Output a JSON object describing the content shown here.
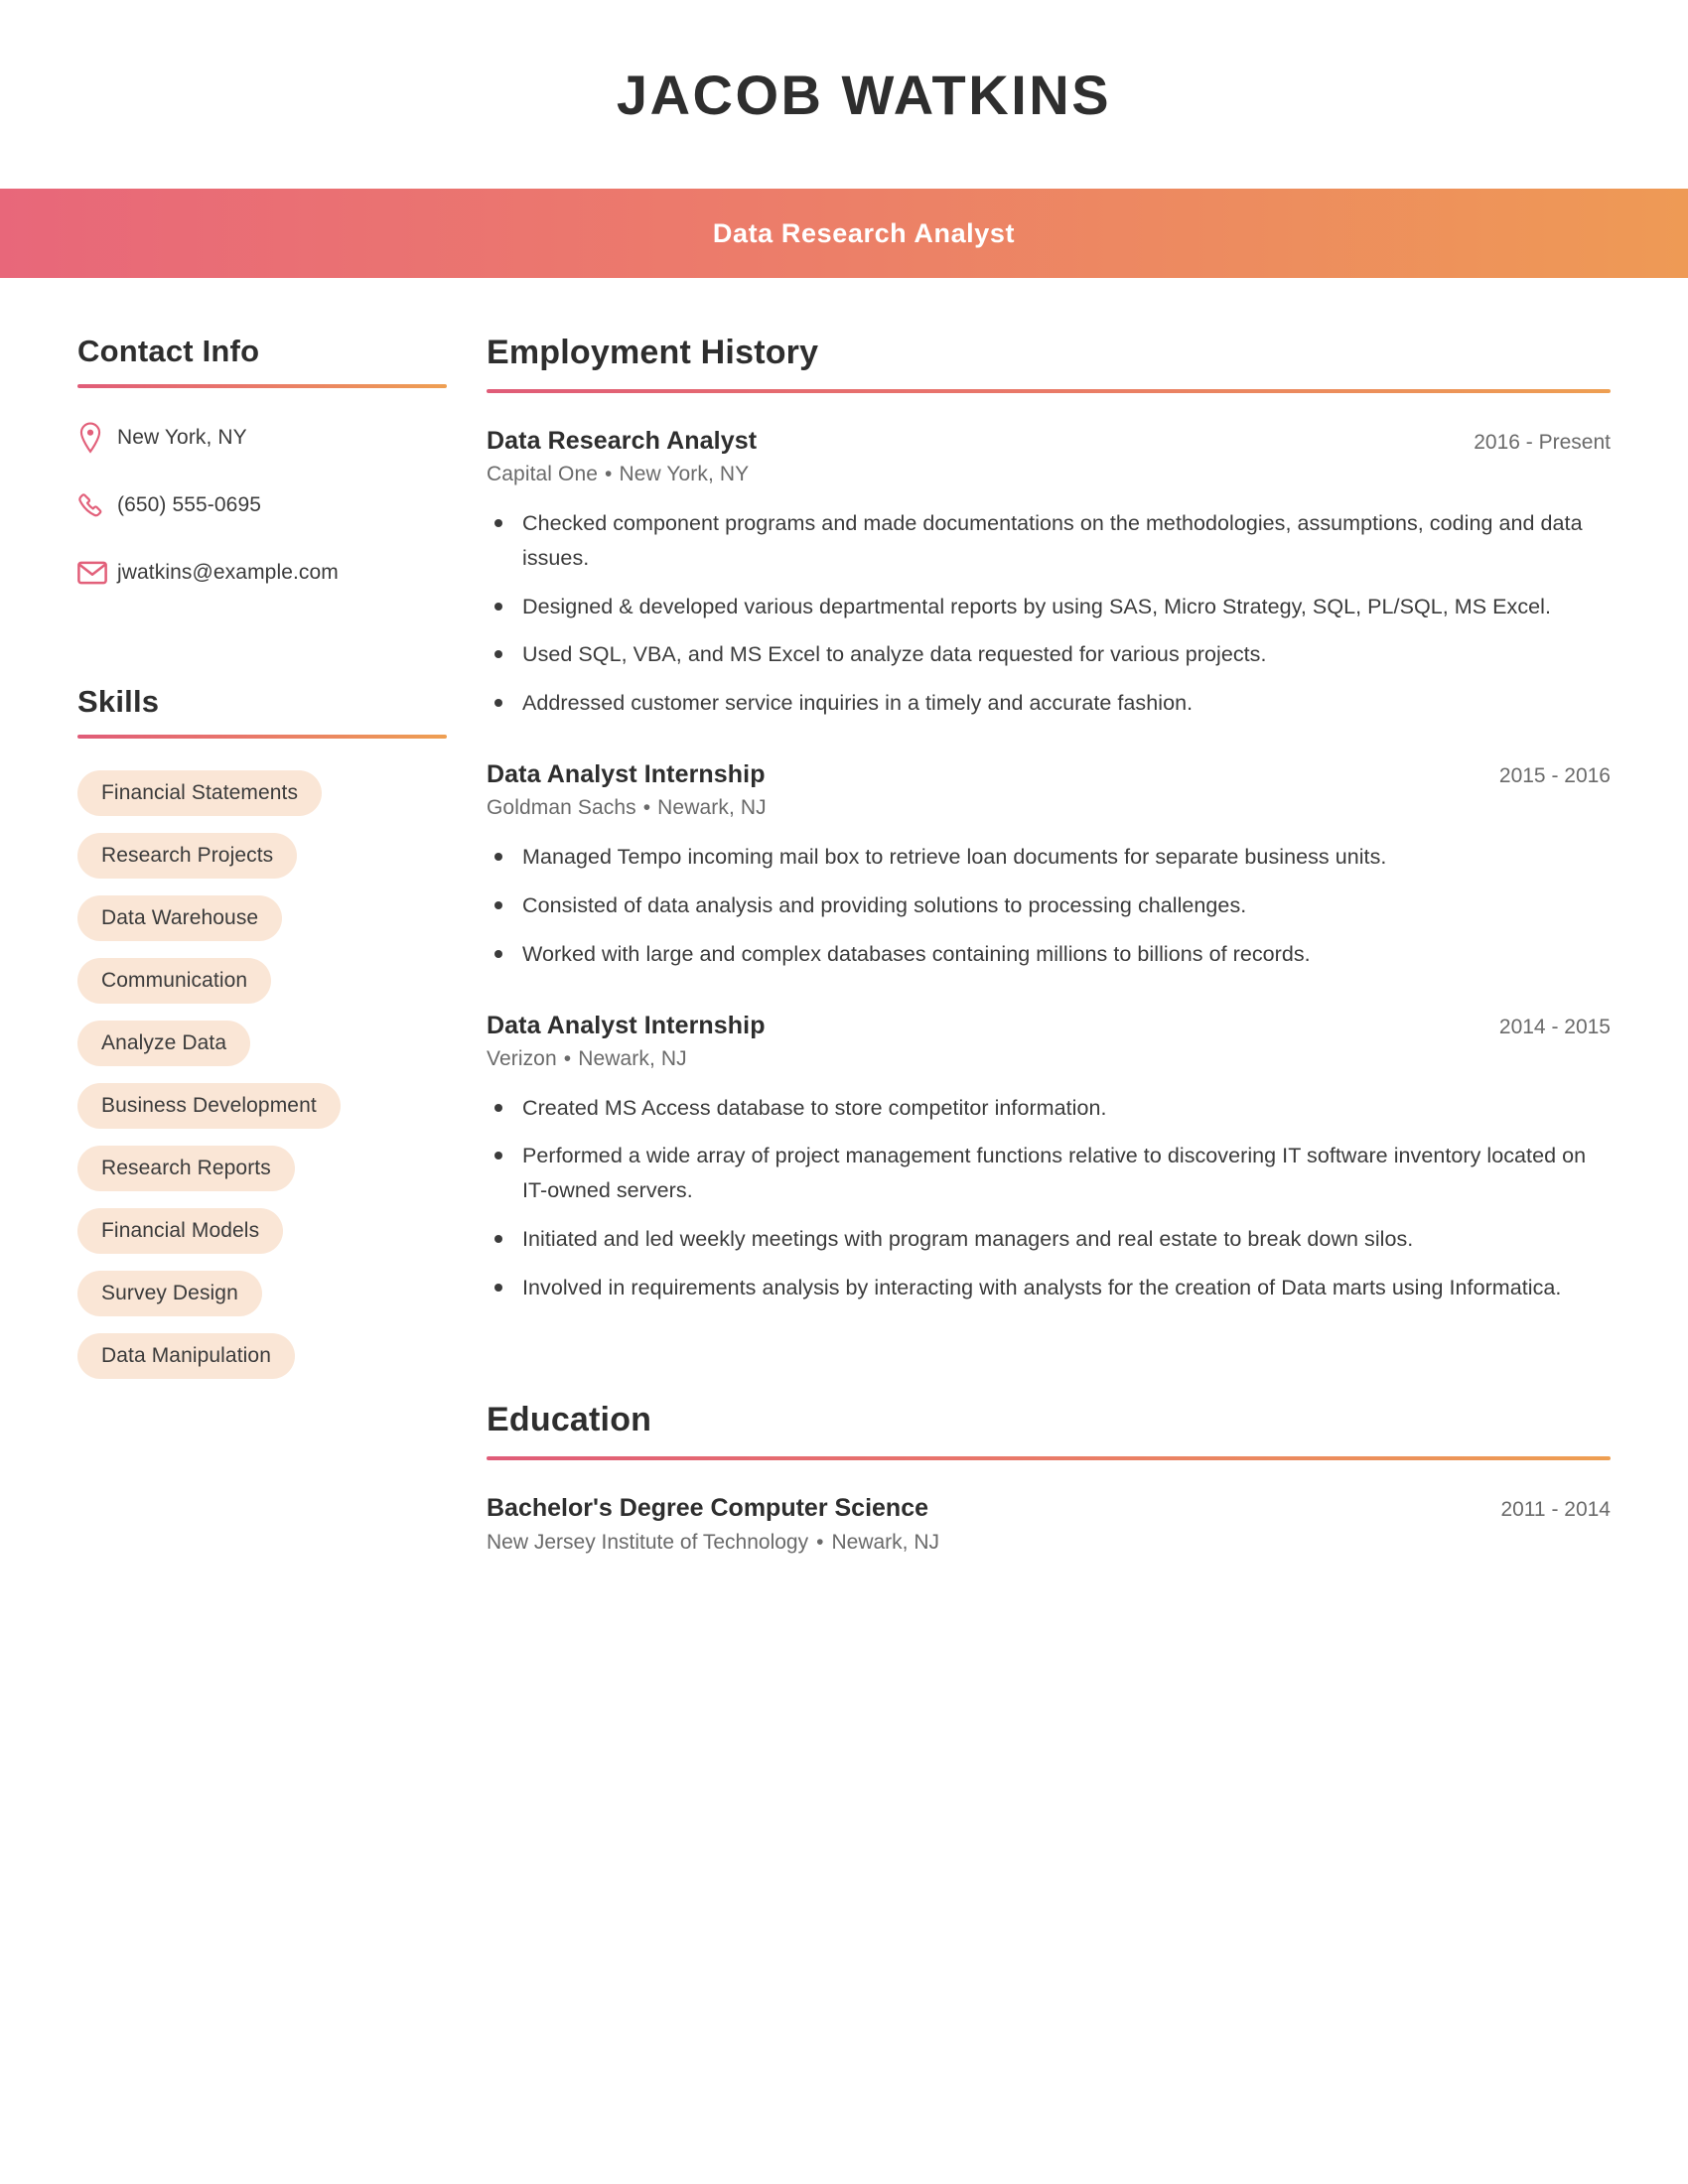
{
  "header": {
    "name": "JACOB WATKINS",
    "job_title": "Data Research Analyst",
    "accent_start": "#e8677a",
    "accent_end": "#ee9a55"
  },
  "sidebar": {
    "contact": {
      "heading": "Contact Info",
      "items": [
        {
          "icon": "location-pin-icon",
          "value": "New York, NY"
        },
        {
          "icon": "phone-icon",
          "value": "(650) 555-0695"
        },
        {
          "icon": "envelope-icon",
          "value": "jwatkins@example.com"
        }
      ]
    },
    "skills": {
      "heading": "Skills",
      "items": [
        "Financial Statements",
        "Research Projects",
        "Data Warehouse",
        "Communication",
        "Analyze Data",
        "Business Development",
        "Research Reports",
        "Financial Models",
        "Survey Design",
        "Data Manipulation"
      ],
      "pill_background": "#fae6d6"
    }
  },
  "main": {
    "employment": {
      "heading": "Employment History",
      "jobs": [
        {
          "title": "Data Research Analyst",
          "dates": "2016 - Present",
          "company": "Capital One",
          "separator": "•",
          "location": "New York, NY",
          "bullets": [
            "Checked component programs and made documentations on the methodologies, assumptions, coding and data issues.",
            "Designed & developed various departmental reports by using SAS, Micro Strategy, SQL, PL/SQL, MS Excel.",
            "Used SQL, VBA, and MS Excel to analyze data requested for various projects.",
            "Addressed customer service inquiries in a timely and accurate fashion."
          ]
        },
        {
          "title": "Data Analyst Internship",
          "dates": "2015 - 2016",
          "company": "Goldman Sachs",
          "separator": "•",
          "location": "Newark, NJ",
          "bullets": [
            "Managed Tempo incoming mail box to retrieve loan documents for separate business units.",
            "Consisted of data analysis and providing solutions to processing challenges.",
            "Worked with large and complex databases containing millions to billions of records."
          ]
        },
        {
          "title": "Data Analyst Internship",
          "dates": "2014 - 2015",
          "company": "Verizon",
          "separator": "•",
          "location": "Newark, NJ",
          "bullets": [
            "Created MS Access database to store competitor information.",
            "Performed a wide array of project management functions relative to discovering IT software inventory located on IT-owned servers.",
            "Initiated and led weekly meetings with program managers and real estate to break down silos.",
            "Involved in requirements analysis by interacting with analysts for the creation of Data marts using Informatica."
          ]
        }
      ]
    },
    "education": {
      "heading": "Education",
      "entries": [
        {
          "degree": "Bachelor's Degree Computer Science",
          "dates": "2011 - 2014",
          "school": "New Jersey Institute of Technology",
          "separator": "•",
          "location": "Newark, NJ"
        }
      ]
    }
  }
}
